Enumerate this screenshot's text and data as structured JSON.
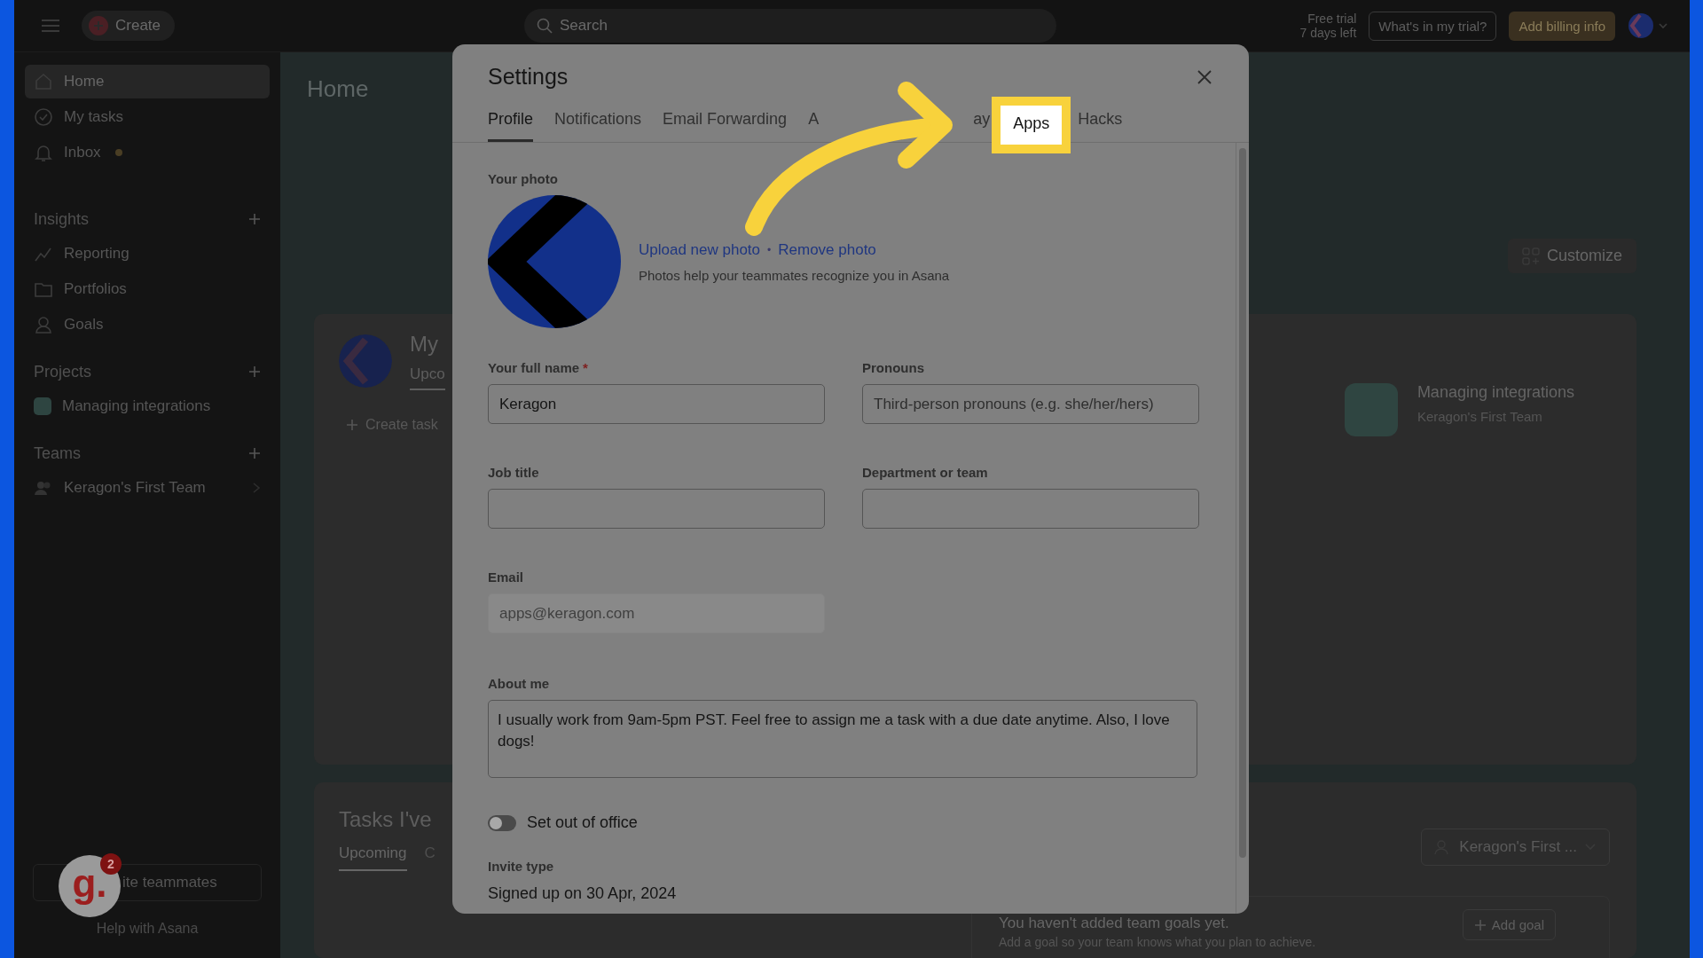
{
  "topbar": {
    "create": "Create",
    "search_placeholder": "Search",
    "trial": [
      "Free trial",
      "7 days left"
    ],
    "trial_button": "What's in my trial?",
    "billing_button": "Add billing info"
  },
  "sidebar": {
    "nav": [
      {
        "label": "Home",
        "selected": true,
        "unread": false
      },
      {
        "label": "My tasks",
        "selected": false,
        "unread": false
      },
      {
        "label": "Inbox",
        "selected": false,
        "unread": true
      }
    ],
    "sections": [
      {
        "title": "Insights",
        "items": [
          {
            "label": "Reporting"
          },
          {
            "label": "Portfolios"
          },
          {
            "label": "Goals"
          }
        ]
      },
      {
        "title": "Projects",
        "items": [
          {
            "label": "Managing integrations",
            "color": "#2e4541"
          }
        ]
      },
      {
        "title": "Teams",
        "items": [
          {
            "label": "Keragon's First Team"
          }
        ]
      }
    ],
    "invite_button": "ite teammates",
    "help": "Help with Asana",
    "widget": {
      "letter": "g.",
      "count": "2"
    }
  },
  "main": {
    "title": "Home",
    "customize": "Customize",
    "my_tasks": {
      "title": "My",
      "tab": "Upco",
      "create": "Create task"
    },
    "project": {
      "name": "Managing integrations",
      "team": "Keragon's First Team"
    },
    "assigned": {
      "title": "Tasks I've",
      "tabs": [
        {
          "label": "Upcoming",
          "selected": true
        },
        {
          "label": "C",
          "selected": false
        }
      ]
    },
    "team_select": "Keragon's First ...",
    "goals": {
      "title": "You haven't added team goals yet.",
      "text": "Add a goal so your team knows what you plan to achieve.",
      "button": "Add goal"
    }
  },
  "settings": {
    "title": "Settings",
    "tabs": [
      {
        "label": "Profile",
        "selected": true,
        "highlighted": false
      },
      {
        "label": "Notifications",
        "selected": false,
        "highlighted": false
      },
      {
        "label": "Email Forwarding",
        "selected": false,
        "highlighted": false
      },
      {
        "label": "A",
        "selected": false,
        "highlighted": false
      },
      {
        "label": "ay",
        "selected": false,
        "highlighted": false
      },
      {
        "label": "Apps",
        "selected": false,
        "highlighted": true
      },
      {
        "label": "Hacks",
        "selected": false,
        "highlighted": false
      }
    ],
    "photo_label": "Your photo",
    "upload": "Upload new photo",
    "separator": "•",
    "remove": "Remove photo",
    "photo_hint": "Photos help your teammates recognize you in Asana",
    "fields": [
      {
        "label": "Your full name",
        "required": true,
        "value": "Keragon",
        "disabled": false
      },
      {
        "label": "Pronouns",
        "required": false,
        "placeholder": "Third-person pronouns (e.g. she/her/hers)",
        "disabled": false
      },
      {
        "label": "Job title",
        "required": false,
        "disabled": false
      },
      {
        "label": "Department or team",
        "required": false,
        "disabled": false
      },
      {
        "label": "Email",
        "required": false,
        "value": "apps@keragon.com",
        "disabled": true
      }
    ],
    "required_mark": "*",
    "about": {
      "label": "About me",
      "value": "I usually work from 9am-5pm PST. Feel free to assign me a task with a due date anytime. Also, I love dogs!"
    },
    "out_of_office": {
      "label": "Set out of office",
      "on": false
    },
    "invite": {
      "label": "Invite type",
      "value": "Signed up on 30 Apr, 2024"
    }
  }
}
